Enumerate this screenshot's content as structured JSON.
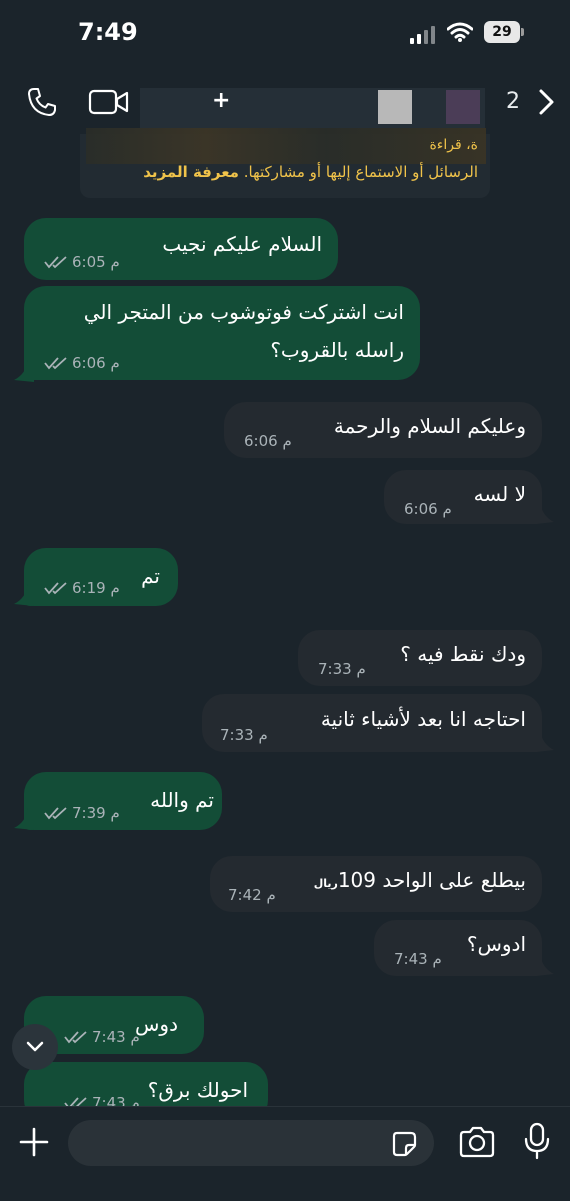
{
  "status_bar": {
    "time": "7:49",
    "battery": "29"
  },
  "header": {
    "plus": "+",
    "count": "2"
  },
  "notice": {
    "line1": "ة، قراءة",
    "line2": "الرسائل أو الاستماع إليها أو مشاركتها.",
    "link": "معرفة المزيد"
  },
  "messages": [
    {
      "dir": "out",
      "lines": [
        "السلام عليكم نجيب"
      ],
      "time": "6:05 م",
      "ticks": true
    },
    {
      "dir": "out",
      "lines": [
        "انت اشتركت فوتوشوب من المتجر الي",
        "راسله بالقروب؟"
      ],
      "time": "6:06 م",
      "ticks": true
    },
    {
      "dir": "in",
      "lines": [
        "وعليكم السلام والرحمة"
      ],
      "time": "6:06 م"
    },
    {
      "dir": "in",
      "lines": [
        "لا لسه"
      ],
      "time": "6:06 م"
    },
    {
      "dir": "out",
      "lines": [
        "تم"
      ],
      "time": "6:19 م",
      "ticks": true
    },
    {
      "dir": "in",
      "lines": [
        "ودك نقط فيه ؟"
      ],
      "time": "7:33 م"
    },
    {
      "dir": "in",
      "lines": [
        "احتاجه انا بعد لأشياء ثانية"
      ],
      "time": "7:33 م"
    },
    {
      "dir": "out",
      "lines": [
        "تم والله"
      ],
      "time": "7:39 م",
      "ticks": true
    },
    {
      "dir": "in",
      "lines": [
        "بيطلع على الواحد 109"
      ],
      "currency": "ريال",
      "time": "7:42 م"
    },
    {
      "dir": "in",
      "lines": [
        "ادوس؟"
      ],
      "time": "7:43 م"
    },
    {
      "dir": "out",
      "lines": [
        "دوس"
      ],
      "time": "7:43 م",
      "ticks": true
    },
    {
      "dir": "out",
      "lines": [
        "احولك برق؟"
      ],
      "time": "7:43 م",
      "ticks": true
    }
  ]
}
